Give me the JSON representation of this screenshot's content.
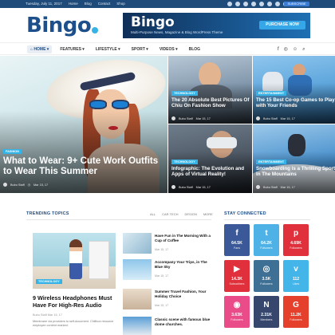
{
  "topbar": {
    "date": "Tuesday, July 11, 2017",
    "links": [
      "Home",
      "Blog",
      "Contact",
      "Shop"
    ],
    "subscribe_label": "SUBSCRIBE"
  },
  "header": {
    "logo_text": "Bingo",
    "banner_title": "Bingo",
    "banner_subtitle": "Multi-Purpose News, Magazine & Blog WordPress Theme",
    "banner_button": "PURCHASE NOW"
  },
  "nav": {
    "items": [
      "HOME",
      "FEATURES",
      "LIFESTYLE",
      "SPORT",
      "VIDEOS",
      "BLOG"
    ]
  },
  "hero": {
    "main": {
      "category": "FASHION",
      "title": "What to Wear: 9+ Cute Work Outfits to Wear This Summer",
      "author": "Bubu Staff",
      "date": "Mar 15, 17"
    },
    "tiles": [
      {
        "category": "TECHNOLOGY",
        "title": "The 20 Absolute Best Pictures Of Chiu On Fashion Show",
        "author": "Bubu Staff",
        "date": "Mar 15, 17"
      },
      {
        "category": "ENTERTAINMENT",
        "title": "The 15 Best Co-op Games to Play with Your Friends",
        "author": "Bubu Staff",
        "date": "Mar 15, 17"
      },
      {
        "category": "TECHNOLOGY",
        "title": "Infographic: The Evolution and Apps of Virtual Reality!",
        "author": "Bubu Staff",
        "date": "Mar 15, 17"
      },
      {
        "category": "ENTERTAINMENT",
        "title": "Snowboarding is a Thrilling Sport In The Mountains",
        "author": "Bubu Staff",
        "date": "Mar 15, 17"
      }
    ]
  },
  "trending": {
    "title": "TRENDING TOPICS",
    "tabs": [
      "ALL",
      "CAR TECH",
      "DESIGN",
      "MORE"
    ],
    "featured": {
      "category": "TECHNOLOGY",
      "title": "9 Wireless Headphones Must Have For High-Res Audio",
      "author": "Bubu Staff",
      "date": "Mar 15, 17",
      "excerpt": "Membrane via providers to self-document. Chillbox resource employee content marked."
    },
    "list": [
      {
        "title": "Have Fun in The Morning With a Cup of Coffee",
        "date": "Mar 15, 17"
      },
      {
        "title": "Accompany Your Trips, in The Blue Sky",
        "date": "Mar 15, 17"
      },
      {
        "title": "Summer Travel Fashion, Your Holiday Choice",
        "date": "Mar 15, 17"
      },
      {
        "title": "Classic scene with famous blue dome churches.",
        "date": "Mar 15, 17"
      }
    ]
  },
  "stay_connected": {
    "title": "STAY CONNECTED",
    "items": [
      {
        "network": "Facebook",
        "icon": "f",
        "count": "64.5K",
        "label": "Fans",
        "color": "#3b5998"
      },
      {
        "network": "Twitter",
        "icon": "t",
        "count": "64.2K",
        "label": "Followers",
        "color": "#4eb2e6"
      },
      {
        "network": "Pinterest",
        "icon": "p",
        "count": "4.69K",
        "label": "Followers",
        "color": "#e0303b"
      },
      {
        "network": "YouTube",
        "icon": "▶",
        "count": "14.3K",
        "label": "Subscribers",
        "color": "#e0303b"
      },
      {
        "network": "Instagram",
        "icon": "◎",
        "count": "3.5K",
        "label": "Followers",
        "color": "#3e6f95"
      },
      {
        "network": "Vimeo",
        "icon": "v",
        "count": "112",
        "label": "Likes",
        "color": "#44b5e8"
      },
      {
        "network": "Dribbble",
        "icon": "◉",
        "count": "3.63K",
        "label": "Followers",
        "color": "#ea4c89"
      },
      {
        "network": "Behance",
        "icon": "N",
        "count": "2.31K",
        "label": "Members",
        "color": "#36466d"
      },
      {
        "network": "Google+",
        "icon": "G",
        "count": "11.2K",
        "label": "Followers",
        "color": "#e4402c"
      }
    ]
  }
}
